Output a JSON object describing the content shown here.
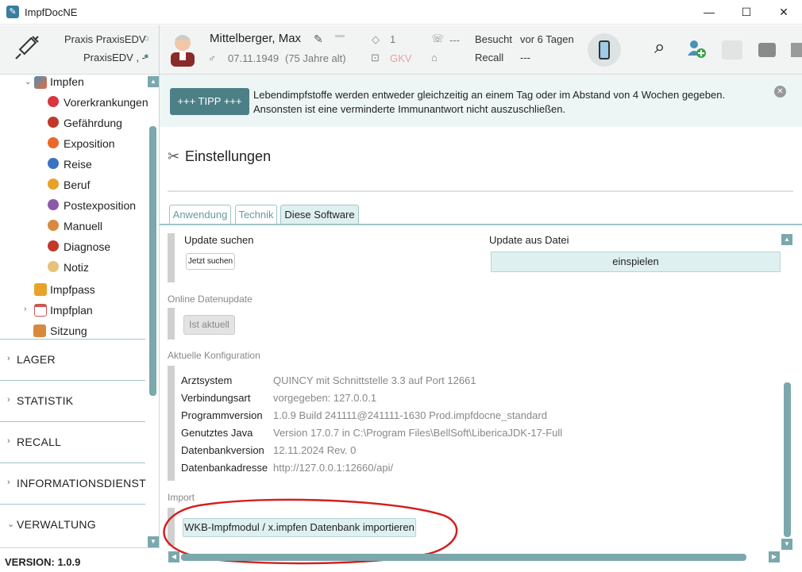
{
  "window": {
    "title": "ImpfDocNE"
  },
  "header": {
    "praxis_label": "Praxis PraxisEDV",
    "user_label": "PraxisEDV , -",
    "patient_name": "Mittelberger, Max",
    "dob": "07.11.1949",
    "age": "(75 Jahre alt)",
    "tag_count": "1",
    "phone": "---",
    "insurance": "GKV",
    "besucht_label": "Besucht",
    "besucht_value": "vor 6 Tagen",
    "recall_label": "Recall",
    "recall_value": "---"
  },
  "sidebar": {
    "impfen_label": "Impfen",
    "items": [
      {
        "label": "Vorerkrankungen",
        "color": "#d9363e"
      },
      {
        "label": "Gefährdung",
        "color": "#c0392b"
      },
      {
        "label": "Exposition",
        "color": "#e8692a"
      },
      {
        "label": "Reise",
        "color": "#3a73c2"
      },
      {
        "label": "Beruf",
        "color": "#e8a22a"
      },
      {
        "label": "Postexposition",
        "color": "#8a5aa8"
      },
      {
        "label": "Manuell",
        "color": "#d9893e"
      },
      {
        "label": "Diagnose",
        "color": "#c0392b"
      },
      {
        "label": "Notiz",
        "color": "#e8c27a"
      }
    ],
    "impfpass_label": "Impfpass",
    "impfplan_label": "Impfplan",
    "sitzung_label": "Sitzung",
    "sections": [
      "LAGER",
      "STATISTIK",
      "RECALL",
      "INFORMATIONSDIENST",
      "VERWALTUNG"
    ],
    "version": "VERSION: 1.0.9"
  },
  "tipp": {
    "button_label": "+++ TIPP +++",
    "text": "Lebendimpfstoffe werden entweder gleichzeitig an einem Tag oder im Abstand von 4 Wochen gegeben. Ansonsten ist eine verminderte Immunantwort nicht auszuschließen."
  },
  "settings": {
    "title": "Einstellungen",
    "tabs": [
      "Anwendung",
      "Technik",
      "Diese Software"
    ],
    "active_tab": "Diese Software",
    "update_label": "Update suchen",
    "update_button": "Jetzt suchen",
    "update_file_label": "Update aus Datei",
    "update_file_button": "einspielen",
    "online_label": "Online Datenupdate",
    "online_button": "Ist aktuell",
    "config_label": "Aktuelle Konfiguration",
    "config": [
      {
        "key": "Arztsystem",
        "value": "QUINCY mit Schnittstelle 3.3 auf Port 12661"
      },
      {
        "key": "Verbindungsart",
        "value": "vorgegeben: 127.0.0.1"
      },
      {
        "key": "Programmversion",
        "value": "1.0.9 Build 241111@241111-1630 Prod.impfdocne_standard"
      },
      {
        "key": "Genutztes Java",
        "value": "Version 17.0.7 in C:\\Program Files\\BellSoft\\LibericaJDK-17-Full"
      },
      {
        "key": "Datenbankversion",
        "value": "12.11.2024 Rev. 0"
      },
      {
        "key": "Datenbankadresse",
        "value": "http://127.0.0.1:12660/api/"
      }
    ],
    "import_label": "Import",
    "import_button": "WKB-Impfmodul / x.impfen Datenbank importieren"
  },
  "colors": {
    "accent": "#4d7f86",
    "highlight_circle": "#d42020"
  }
}
